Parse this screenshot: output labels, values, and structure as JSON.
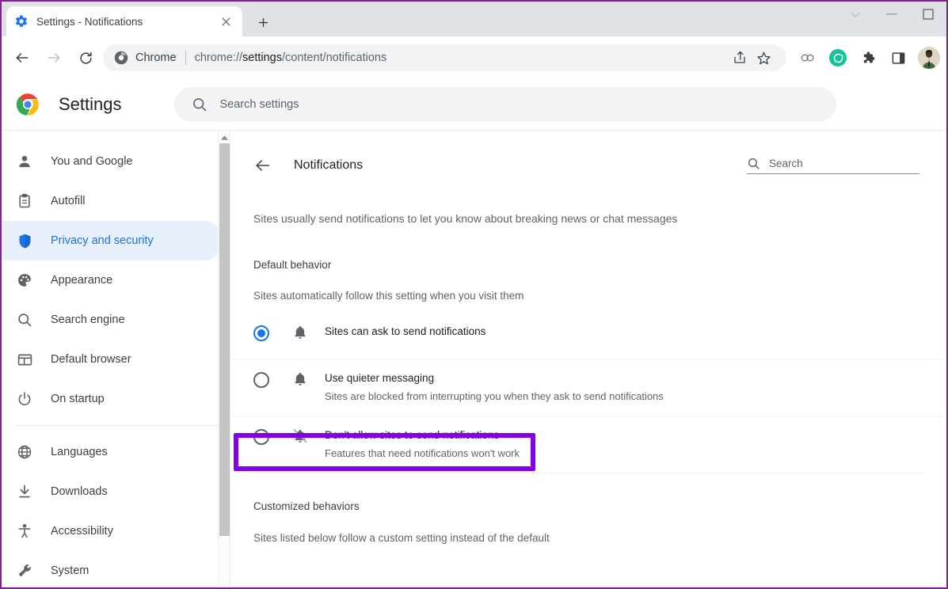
{
  "window": {
    "tab": {
      "title": "Settings - Notifications",
      "favicon_icon": "blue-gear-icon",
      "close_icon": "close-icon"
    },
    "new_tab_icon": "plus-icon",
    "controls": [
      {
        "name": "tab-search",
        "icon": "chevron-down-icon",
        "label": "∨"
      },
      {
        "name": "minimize",
        "icon": "minimize-icon",
        "label": "–"
      },
      {
        "name": "maximize",
        "icon": "maximize-icon",
        "label": "□"
      }
    ]
  },
  "toolbar": {
    "back_icon": "back-arrow-icon",
    "forward_icon": "forward-arrow-icon",
    "reload_icon": "reload-icon",
    "omnibox": {
      "chrome_icon": "chrome-icon",
      "scheme_label": "Chrome",
      "url_prefix": "chrome://",
      "url_strong": "settings",
      "url_suffix": "/content/notifications",
      "full_url": "chrome://settings/content/notifications",
      "share_icon": "share-icon",
      "bookmark_icon": "star-icon"
    },
    "actions": [
      {
        "name": "link-preview",
        "icon": "chain-link-icon"
      },
      {
        "name": "grammarly-extension",
        "icon": "grammarly-icon"
      },
      {
        "name": "extensions",
        "icon": "puzzle-piece-icon"
      },
      {
        "name": "side-panel",
        "icon": "side-panel-icon"
      }
    ],
    "avatar_icon": "user-avatar"
  },
  "settings_header": {
    "logo_icon": "chrome-logo-icon",
    "title": "Settings",
    "search": {
      "icon": "search-icon",
      "placeholder": "Search settings",
      "value": ""
    }
  },
  "sidebar": {
    "group_one": [
      {
        "label": "You and Google",
        "icon": "person-icon",
        "active": false
      },
      {
        "label": "Autofill",
        "icon": "clipboard-icon",
        "active": false
      },
      {
        "label": "Privacy and security",
        "icon": "shield-icon",
        "active": true
      },
      {
        "label": "Appearance",
        "icon": "palette-icon",
        "active": false
      },
      {
        "label": "Search engine",
        "icon": "magnifier-icon",
        "active": false
      },
      {
        "label": "Default browser",
        "icon": "browser-window-icon",
        "active": false
      },
      {
        "label": "On startup",
        "icon": "power-icon",
        "active": false
      }
    ],
    "group_two": [
      {
        "label": "Languages",
        "icon": "globe-icon",
        "active": false
      },
      {
        "label": "Downloads",
        "icon": "download-icon",
        "active": false
      },
      {
        "label": "Accessibility",
        "icon": "accessibility-icon",
        "active": false
      },
      {
        "label": "System",
        "icon": "wrench-icon",
        "active": false
      }
    ],
    "scrollbar": {
      "up_arrow_icon": "scroll-up-arrow-icon"
    }
  },
  "main": {
    "back_icon": "back-arrow-icon",
    "page_title": "Notifications",
    "search": {
      "icon": "search-icon",
      "placeholder": "Search",
      "value": ""
    },
    "intro": "Sites usually send notifications to let you know about breaking news or chat messages",
    "default_behavior": {
      "heading": "Default behavior",
      "subtext": "Sites automatically follow this setting when you visit them",
      "options": [
        {
          "title": "Sites can ask to send notifications",
          "desc": "",
          "icon": "bell-icon",
          "selected": true,
          "highlighted": true
        },
        {
          "title": "Use quieter messaging",
          "desc": "Sites are blocked from interrupting you when they ask to send notifications",
          "icon": "bell-icon",
          "selected": false,
          "highlighted": false
        },
        {
          "title": "Don't allow sites to send notifications",
          "desc": "Features that need notifications won't work",
          "icon": "bell-off-icon",
          "selected": false,
          "highlighted": false
        }
      ]
    },
    "customized_behaviors": {
      "heading": "Customized behaviors",
      "subtext": "Sites listed below follow a custom setting instead of the default"
    }
  },
  "colors": {
    "highlight_purple": "#8400e7",
    "chrome_blue": "#1a73e8",
    "active_nav_bg": "#e8f0fe",
    "tabstrip_bg": "#dee1e6",
    "field_bg": "#f1f3f4",
    "text_primary": "#202124",
    "text_secondary": "#5f6368",
    "window_border": "#8b1a9b"
  }
}
